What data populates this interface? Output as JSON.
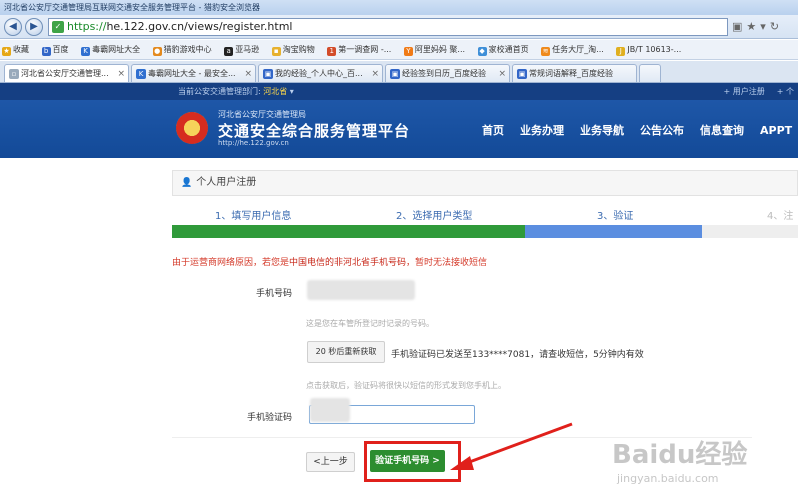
{
  "browser": {
    "window_title": "河北省公安厅交通管理局互联网交通安全服务管理平台 - 猎豹安全浏览器",
    "url_scheme": "https://",
    "url_rest": "he.122.gov.cn/views/register.html",
    "bookmarks": [
      "收藏",
      "百度",
      "毒霸网址大全",
      "猎豹游戏中心",
      "亚马逊",
      "淘宝购物",
      "第一调查网 -...",
      "阿里妈妈 聚...",
      "家校通首页",
      "任务大厅_淘...",
      "JB/T 10613-..."
    ],
    "tabs": [
      {
        "label": "河北省公安厅交通管理..."
      },
      {
        "label": "毒霸网址大全 - 最安全..."
      },
      {
        "label": "我的经验_个人中心_百..."
      },
      {
        "label": "经验签到日历_百度经验"
      },
      {
        "label": "常规词语解释_百度经验"
      }
    ]
  },
  "site": {
    "region_label": "当前公安交通管理部门:",
    "region_value": "河北省",
    "top_links": [
      "+ 用户注册",
      "+ 个"
    ],
    "subtitle": "河北省公安厅交通管理局",
    "title": "交通安全综合服务管理平台",
    "url": "http://he.122.gov.cn",
    "nav": [
      "首页",
      "业务办理",
      "业务导航",
      "公告公布",
      "信息查询",
      "APPT"
    ]
  },
  "form": {
    "panel_title": "个人用户注册",
    "steps": [
      "1、填写用户信息",
      "2、选择用户类型",
      "3、验证",
      "4、注"
    ],
    "notice_pre": "由于运营商网络原因，若您是",
    "notice_hl": "中国电信的非河北省手机号码",
    "notice_post": "，暂时无法接收短信",
    "phone_label": "手机号码",
    "phone_hint": "这是您在车管所登记时记录的号码。",
    "resend_label": "20 秒后重新获取",
    "sent_msg": "手机验证码已发送至133****7081，请查收短信，5分钟内有效",
    "resend_hint": "点击获取后，验证码将很快以短信的形式发到您手机上。",
    "code_label": "手机验证码",
    "prev_label": "<上一步",
    "verify_label": "验证手机号码 >"
  },
  "watermark": {
    "main": "Baidu经验",
    "sub": "jingyan.baidu.com"
  }
}
